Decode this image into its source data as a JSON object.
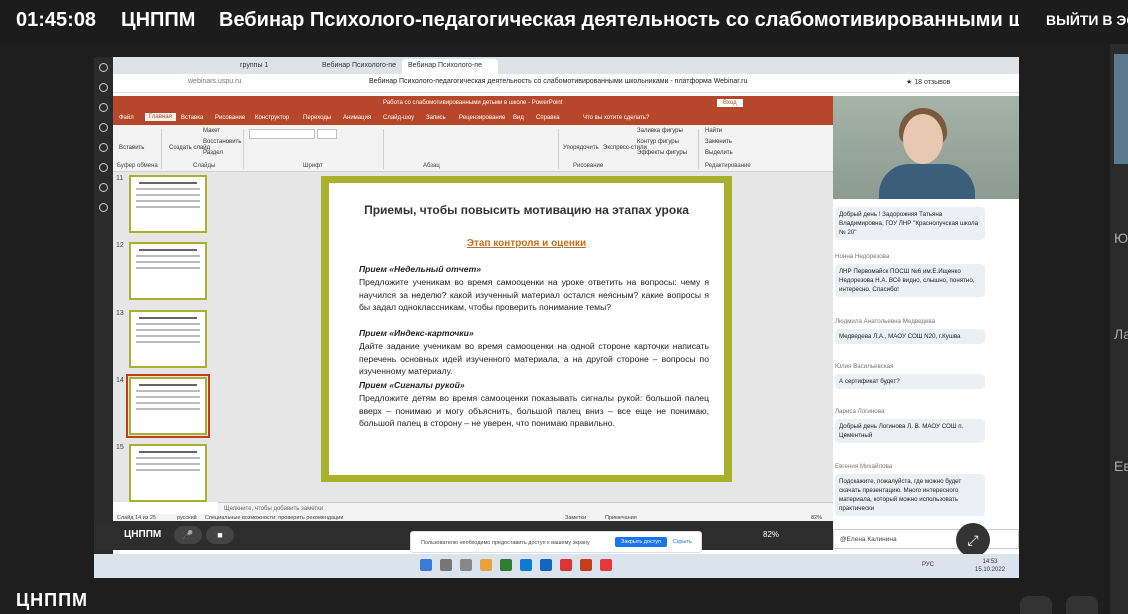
{
  "top_bar": {
    "time": "01:45:08",
    "org": "ЦНППМ",
    "title": "Вебинар Психолого-педагогическая деятельность со слабомотивированными ш",
    "exit": "ВЫЙТИ В ЭС"
  },
  "right_strip": {
    "labels": [
      "Ю",
      "Ла",
      "Ев"
    ]
  },
  "bottom": {
    "logo": "ЦНППМ"
  },
  "browser": {
    "tabs": [
      "группы 1",
      "Вебинар Психолого-пе",
      "Вебинар Психолого-пе"
    ],
    "url": "webinars.uspu.ru",
    "page_title": "Вебинар Психолого-педагогическая деятельность со слабомотивированными школьниками - платформа Webinar.ru",
    "reviews": "★ 18 отзывов"
  },
  "ppt": {
    "window_title": "Работа со слабомотивированными детьми в школе - PowerPoint",
    "signin": "Вход",
    "menu": [
      "Файл",
      "Главная",
      "Вставка",
      "Рисование",
      "Конструктор",
      "Переходы",
      "Анимация",
      "Слайд-шоу",
      "Запись",
      "Рецензирование",
      "Вид",
      "Справка",
      "Что вы хотите сделать?"
    ],
    "ribbon": {
      "groups": [
        "Буфер обмена",
        "Слайды",
        "Шрифт",
        "Абзац",
        "Рисование",
        "Редактирование"
      ],
      "paste": "Вставить",
      "new_slide": "Создать слайд",
      "reuse": "Повторно использовать слайды",
      "layout": "Макет",
      "reset": "Восстановить",
      "section": "Раздел",
      "arrange": "Упорядочить",
      "styles": "Экспресс-стили",
      "fill": "Заливка фигуры",
      "outline": "Контур фигуры",
      "effects": "Эффекты фигуры",
      "find": "Найти",
      "replace": "Заменить",
      "select": "Выделить"
    },
    "thumb_numbers": [
      "11",
      "12",
      "13",
      "14",
      "15"
    ],
    "slide": {
      "heading": "Приемы, чтобы повысить мотивацию  на этапах урока",
      "subheading": "Этап контроля и оценки",
      "blocks": [
        {
          "title": "Прием «Недельный отчет»",
          "text": "Предложите ученикам во время самооценки на уроке ответить на вопросы: чему я научился за неделю? какой изученный материал остался неясным? какие вопросы я бы задал одноклассникам, чтобы проверить понимание темы?"
        },
        {
          "title": "Прием «Индекс-карточки»",
          "text": "Дайте задание ученикам во время самооценки на одной стороне карточки написать перечень основных идей изученного материала, а на другой стороне – вопросы по изученному материалу."
        },
        {
          "title": "Прием «Сигналы рукой»",
          "text": "Предложите детям во время самооценки показывать сигналы рукой: большой палец вверх – понимаю и могу объяснить, большой палец вниз – все еще не понимаю, большой палец в сторону – не уверен, что понимаю правильно."
        }
      ]
    },
    "notes": "Щелкните, чтобы добавить заметки",
    "status": {
      "slide_of": "Слайд 14 из 25",
      "lang": "русский",
      "accessibility": "Специальные возможности: проверить рекомендации",
      "notes_btn": "Заметки",
      "comments": "Примечания",
      "zoom": "82%"
    }
  },
  "chat": {
    "messages": [
      {
        "author": "",
        "text": "Добрый день ! Задорожняя Татьяна Владимировна, ГОУ ЛНР \"Краснолучская школа № 20\""
      },
      {
        "author": "Нонна Недорезова",
        "text": "ЛНР Первомайск ПОСШ №6 им.Е.Ищенко Недорезова Н.А. ВСё видно, слышно, понятно, интересно. Спасибо!"
      },
      {
        "author": "Людмила Анатольевна Медведева",
        "text": "Медведева Л.А., МАОУ СОШ N20, г.Кушва"
      },
      {
        "author": "Юлия Васильевская",
        "text": "А сертификат будет?"
      },
      {
        "author": "Лариса Логинова",
        "text": "Добрый день Логинова Л. В. МАОУ СОШ п. Цементный"
      },
      {
        "author": "Евгения Михайлова",
        "text": "Подскажите, пожалуйста, где можно будет скачать презентацию. Много интересного материала, который можно использовать практически"
      }
    ],
    "input_value": "@Елена Калинина"
  },
  "webinar": {
    "logo": "ЦНППМ",
    "zoom": "82%",
    "banner_text": "Произошла ошибка доступа к камере и микрофону. Предоставьте доступ к вашему экрану.",
    "banner_text_short": "Пользователю необходимо предоставить доступ к вашему экрану",
    "banner_btn": "Закрыть доступ",
    "banner_link": "Скрыть"
  },
  "taskbar": {
    "lang": "РУС",
    "time": "14:53",
    "date": "15.10.2022"
  }
}
